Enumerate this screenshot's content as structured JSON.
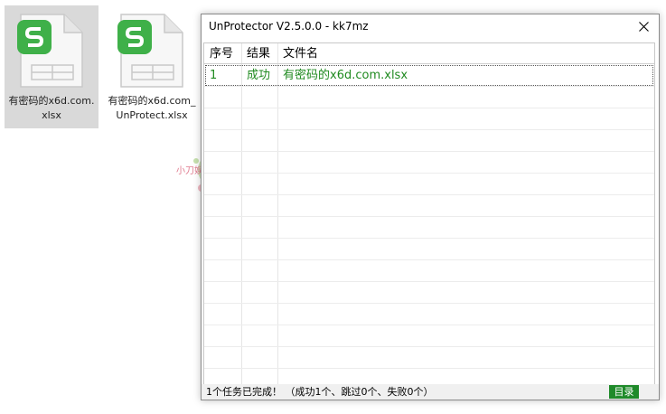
{
  "desktop": {
    "items": [
      {
        "name": "有密码的x6d.com.xlsx",
        "selected": true
      },
      {
        "name": "有密码的x6d.com_UnProtect.xlsx",
        "selected": false
      }
    ]
  },
  "watermark": {
    "text": "小刀娱乐 乐于分享"
  },
  "window": {
    "title": "UnProtector V2.5.0.0 - kk7mz",
    "columns": [
      "序号",
      "结果",
      "文件名"
    ],
    "rows": [
      {
        "index": "1",
        "result": "成功",
        "file": "有密码的x6d.com.xlsx"
      }
    ],
    "status": "1个任务已完成！ （成功1个、跳过0个、失败0个）",
    "dir_button": "目录"
  },
  "colors": {
    "success_text": "#1f8a1f",
    "dir_button_bg": "#1f8a2a",
    "xlsx_icon": "#3fb049"
  },
  "icons": [
    "xlsx-file-icon",
    "close-icon"
  ]
}
